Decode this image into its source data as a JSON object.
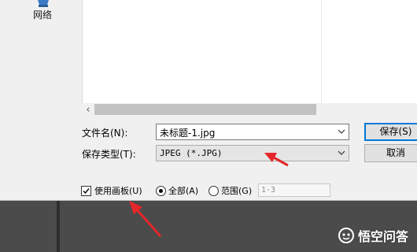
{
  "nav": {
    "network_label": "网络"
  },
  "filename": {
    "label": "文件名(N):",
    "value": "未标题-1.jpg"
  },
  "filetype": {
    "label": "保存类型(T):",
    "value": "JPEG (*.JPG)"
  },
  "buttons": {
    "save": "保存(S)",
    "cancel": "取消"
  },
  "options": {
    "use_artboard": {
      "label": "使用画板(U)",
      "checked": true
    },
    "all": {
      "label": "全部(A)",
      "selected": true
    },
    "range": {
      "label": "范围(G)",
      "selected": false,
      "value": "1-3"
    }
  },
  "watermark": {
    "text": "悟空问答"
  },
  "colors": {
    "accent": "#0078d7",
    "arrow": "#e5262a",
    "dialog_bg": "#f0f0f0",
    "backdrop": "#4b4b4b"
  }
}
